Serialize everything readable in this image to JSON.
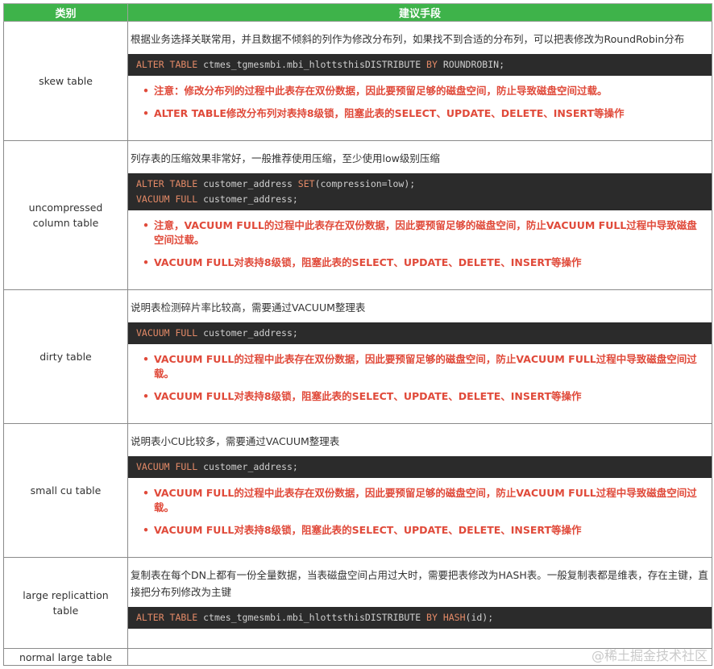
{
  "header": {
    "col1": "类别",
    "col2": "建议手段"
  },
  "rows": [
    {
      "category": "skew table",
      "description": "根据业务选择关联常用，并且数据不倾斜的列作为修改分布列，如果找不到合适的分布列，可以把表修改为RoundRobin分布",
      "code": [
        [
          "ALTER TABLE",
          " ctmes_tgmesmbi.mbi_hlottsthisDISTRIBUTE ",
          "BY",
          " ROUNDROBIN;"
        ]
      ],
      "notes": [
        "注意：修改分布列的过程中此表存在双份数据，因此要预留足够的磁盘空间，防止导致磁盘空间过载。",
        "ALTER TABLE修改分布列对表持8级锁，阻塞此表的SELECT、UPDATE、DELETE、INSERT等操作"
      ]
    },
    {
      "category": "uncompressed column table",
      "description": "列存表的压缩效果非常好，一般推荐使用压缩，至少使用low级别压缩",
      "code": [
        [
          "ALTER TABLE",
          " customer_address ",
          "SET",
          "(compression=low);"
        ],
        [
          "VACUUM FULL",
          " customer_address;",
          "",
          ""
        ]
      ],
      "notes": [
        "注意，VACUUM FULL的过程中此表存在双份数据，因此要预留足够的磁盘空间，防止VACUUM FULL过程中导致磁盘空间过载。",
        "VACUUM FULL对表持8级锁，阻塞此表的SELECT、UPDATE、DELETE、INSERT等操作"
      ]
    },
    {
      "category": "dirty table",
      "description": "说明表检测碎片率比较高，需要通过VACUUM整理表",
      "code": [
        [
          "VACUUM FULL",
          " customer_address;",
          "",
          ""
        ]
      ],
      "notes": [
        "VACUUM FULL的过程中此表存在双份数据，因此要预留足够的磁盘空间，防止VACUUM FULL过程中导致磁盘空间过载。",
        "VACUUM FULL对表持8级锁，阻塞此表的SELECT、UPDATE、DELETE、INSERT等操作"
      ]
    },
    {
      "category": "small cu table",
      "description": "说明表小CU比较多，需要通过VACUUM整理表",
      "code": [
        [
          "VACUUM FULL",
          " customer_address;",
          "",
          ""
        ]
      ],
      "notes": [
        "VACUUM FULL的过程中此表存在双份数据，因此要预留足够的磁盘空间，防止VACUUM FULL过程中导致磁盘空间过载。",
        "VACUUM FULL对表持8级锁，阻塞此表的SELECT、UPDATE、DELETE、INSERT等操作"
      ]
    },
    {
      "category": "large replicattion table",
      "description": "复制表在每个DN上都有一份全量数据，当表磁盘空间占用过大时，需要把表修改为HASH表。一般复制表都是维表，存在主键，直接把分布列修改为主键",
      "code": [
        [
          "ALTER TABLE",
          " ctmes_tgmesmbi.mbi_hlottsthisDISTRIBUTE ",
          "BY HASH",
          "(id);"
        ]
      ],
      "notes": []
    },
    {
      "category": "normal large table",
      "description": "",
      "code": [],
      "notes": []
    }
  ],
  "watermark": "@稀土掘金技术社区"
}
